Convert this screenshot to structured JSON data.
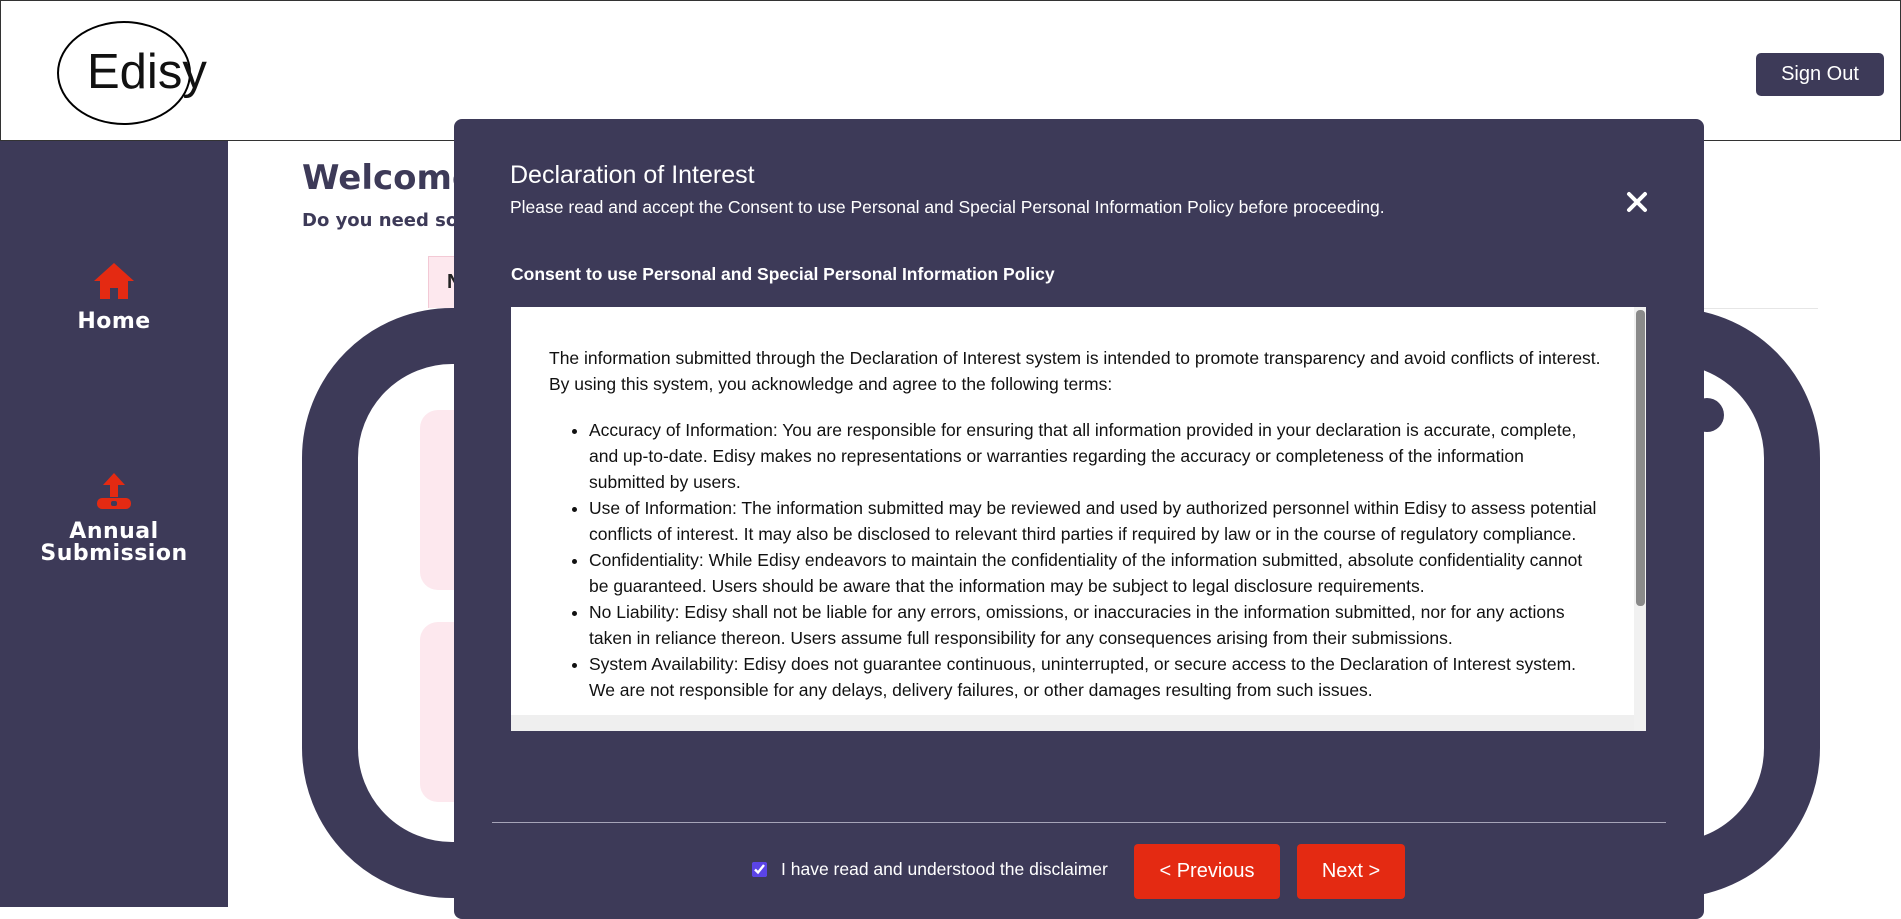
{
  "header": {
    "logo_text": "Edisy",
    "signout_label": "Sign Out"
  },
  "sidebar": {
    "items": [
      {
        "label": "Home",
        "icon": "home-icon",
        "icon_color": "#e42a12"
      },
      {
        "label": "Annual Submission",
        "icon": "upload-icon",
        "icon_color": "#e42a12"
      }
    ]
  },
  "main": {
    "welcome": "Welcome",
    "help": "Do you need so",
    "tab_stub": "N"
  },
  "modal": {
    "title": "Declaration of Interest",
    "subtitle": "Please read and accept the Consent to use Personal and Special Personal Information Policy before proceeding.",
    "policy_heading": "Consent to use Personal and Special Personal Information Policy",
    "intro": "The information submitted through the Declaration of Interest system is intended to promote transparency and avoid conflicts of interest. By using this system, you acknowledge and agree to the following terms:",
    "terms": [
      "Accuracy of Information: You are responsible for ensuring that all information provided in your declaration is accurate, complete, and up-to-date. Edisy makes no representations or warranties regarding the accuracy or completeness of the information submitted by users.",
      "Use of Information: The information submitted may be reviewed and used by authorized personnel within Edisy to assess potential conflicts of interest. It may also be disclosed to relevant third parties if required by law or in the course of regulatory compliance.",
      "Confidentiality: While Edisy endeavors to maintain the confidentiality of the information submitted, absolute confidentiality cannot be guaranteed. Users should be aware that the information may be subject to legal disclosure requirements.",
      "No Liability: Edisy shall not be liable for any errors, omissions, or inaccuracies in the information submitted, nor for any actions taken in reliance thereon. Users assume full responsibility for any consequences arising from their submissions.",
      "System Availability: Edisy does not guarantee continuous, uninterrupted, or secure access to the Declaration of Interest system. We are not responsible for any delays, delivery failures, or other damages resulting from such issues."
    ],
    "checkbox_label": "I have read and understood the disclaimer",
    "checkbox_checked": true,
    "previous_label": "< Previous",
    "next_label": "Next >"
  },
  "colors": {
    "brand_dark": "#3d3a58",
    "accent_red": "#e42a12",
    "pink_light": "#fde8ee"
  }
}
